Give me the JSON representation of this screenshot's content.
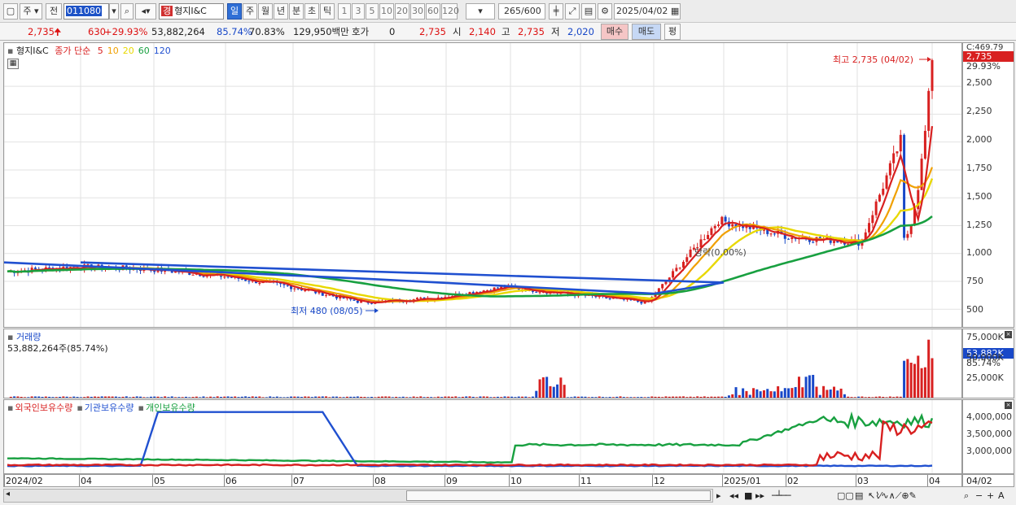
{
  "toolbar": {
    "mode1": "주",
    "mode2": "전",
    "code": "011080",
    "stock_tag": "경",
    "stock_name": "형지I&C",
    "period_tabs": [
      "일",
      "주",
      "월",
      "년",
      "분",
      "초",
      "틱"
    ],
    "selected_period": "일",
    "intervals": [
      "1",
      "3",
      "5",
      "10",
      "20",
      "30",
      "60",
      "120"
    ],
    "count": "265",
    "count_total": "/600",
    "date": "2025/04/02"
  },
  "quote": {
    "price": "2,735",
    "change": "630",
    "change_pct": "+29.93%",
    "volume": "53,882,264",
    "vol_ratio": "85.74%",
    "ratio2": "70.83%",
    "amount": "129,950백만",
    "hoga_label": "호가",
    "hoga_val": "0",
    "hoga_price": "2,735",
    "open_label": "시",
    "open": "2,140",
    "high_label": "고",
    "high": "2,735",
    "low_label": "저",
    "low": "2,020",
    "buy": "매수",
    "sell": "매도",
    "avg": "평"
  },
  "price_panel": {
    "title": "형지I&C",
    "legend_prefix": "종가 단순",
    "ma_labels": [
      "5",
      "10",
      "20",
      "60",
      "120"
    ],
    "ma_colors": [
      "#d82020",
      "#f0a000",
      "#e8d800",
      "#18a040",
      "#2050d0"
    ],
    "high_annotation": "최고 2,735 (04/02)",
    "low_annotation": "최저 480 (08/05)",
    "mid_annotation": "당락(0.00%)",
    "axis_top": "C:469.79",
    "axis_price": "2,735",
    "axis_pct": "29.93%",
    "y_ticks": [
      "2,500",
      "2,250",
      "2,000",
      "1,750",
      "1,500",
      "1,250",
      "1,000",
      "750",
      "500"
    ]
  },
  "volume_panel": {
    "title": "거래량",
    "subtitle": "53,882,264주(85.74%)",
    "axis_value": "53,882K",
    "axis_pct": "85.74%",
    "y_ticks": [
      "75,000K",
      "50,000K",
      "25,000K"
    ]
  },
  "holding_panel": {
    "legend": [
      "외국인보유수량",
      "기관보유수량",
      "개인보유수량"
    ],
    "legend_colors": [
      "#d82020",
      "#2050d0",
      "#18a040"
    ],
    "y_ticks": [
      "4,000,000",
      "3,500,000",
      "3,000,000"
    ]
  },
  "x_axis": {
    "labels": [
      "2024/02",
      "04",
      "05",
      "06",
      "07",
      "08",
      "09",
      "10",
      "11",
      "12",
      "2025/01",
      "02",
      "03",
      "04"
    ],
    "right_label": "04/02"
  },
  "chart_data": {
    "type": "candlestick",
    "title": "형지I&C",
    "x_range": [
      "2024/02",
      "2025/04/02"
    ],
    "high": {
      "value": 2735,
      "date": "04/02"
    },
    "low": {
      "value": 480,
      "date": "08/05"
    },
    "close_points": [
      {
        "x": "2024/02",
        "y": 840
      },
      {
        "x": "04",
        "y": 880
      },
      {
        "x": "05",
        "y": 860
      },
      {
        "x": "06",
        "y": 800
      },
      {
        "x": "07",
        "y": 700
      },
      {
        "x": "08",
        "y": 560
      },
      {
        "x": "09",
        "y": 600
      },
      {
        "x": "10",
        "y": 700
      },
      {
        "x": "11",
        "y": 630
      },
      {
        "x": "12",
        "y": 560
      },
      {
        "x": "2025/01",
        "y": 1300
      },
      {
        "x": "02",
        "y": 1150
      },
      {
        "x": "03",
        "y": 1100
      },
      {
        "x": "04",
        "y": 2735
      }
    ],
    "ma120_points": [
      {
        "x": "2024/02",
        "y": 920
      },
      {
        "x": "08",
        "y": 770
      },
      {
        "x": "12",
        "y": 640
      },
      {
        "x": "2025/01",
        "y": 740
      },
      {
        "x": "04",
        "y": 920
      }
    ],
    "ylim": [
      400,
      2800
    ],
    "volume_ylim": [
      0,
      80000000
    ],
    "holding_ylim": [
      2600000,
      4300000
    ]
  }
}
